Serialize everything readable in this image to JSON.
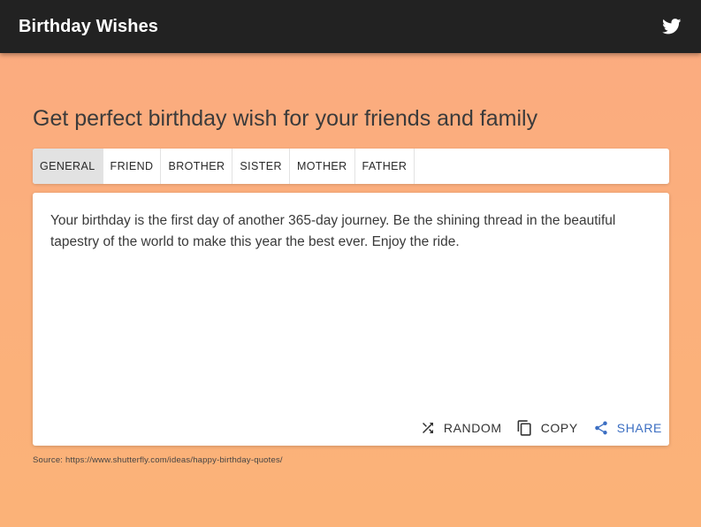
{
  "app": {
    "title": "Birthday Wishes",
    "twitter_icon": "twitter-icon"
  },
  "main": {
    "headline": "Get perfect birthday wish for your friends and family",
    "tabs": [
      {
        "label": "GENERAL",
        "active": true
      },
      {
        "label": "FRIEND",
        "active": false
      },
      {
        "label": "BROTHER",
        "active": false
      },
      {
        "label": "SISTER",
        "active": false
      },
      {
        "label": "MOTHER",
        "active": false
      },
      {
        "label": "FATHER",
        "active": false
      }
    ],
    "wish_text": "Your birthday is the first day of another 365-day journey. Be the shining thread in the beautiful tapestry of the world to make this year the best ever. Enjoy the ride.",
    "actions": {
      "random": {
        "label": "RANDOM",
        "icon": "shuffle-icon"
      },
      "copy": {
        "label": "COPY",
        "icon": "copy-icon"
      },
      "share": {
        "label": "SHARE",
        "icon": "share-icon"
      }
    },
    "source": "Source: https://www.shutterfly.com/ideas/happy-birthday-quotes/"
  },
  "colors": {
    "appbar_bg": "#222222",
    "background": "#fbaa80",
    "accent": "#3b6ec2",
    "active_tab_bg": "#e2e2e2"
  }
}
